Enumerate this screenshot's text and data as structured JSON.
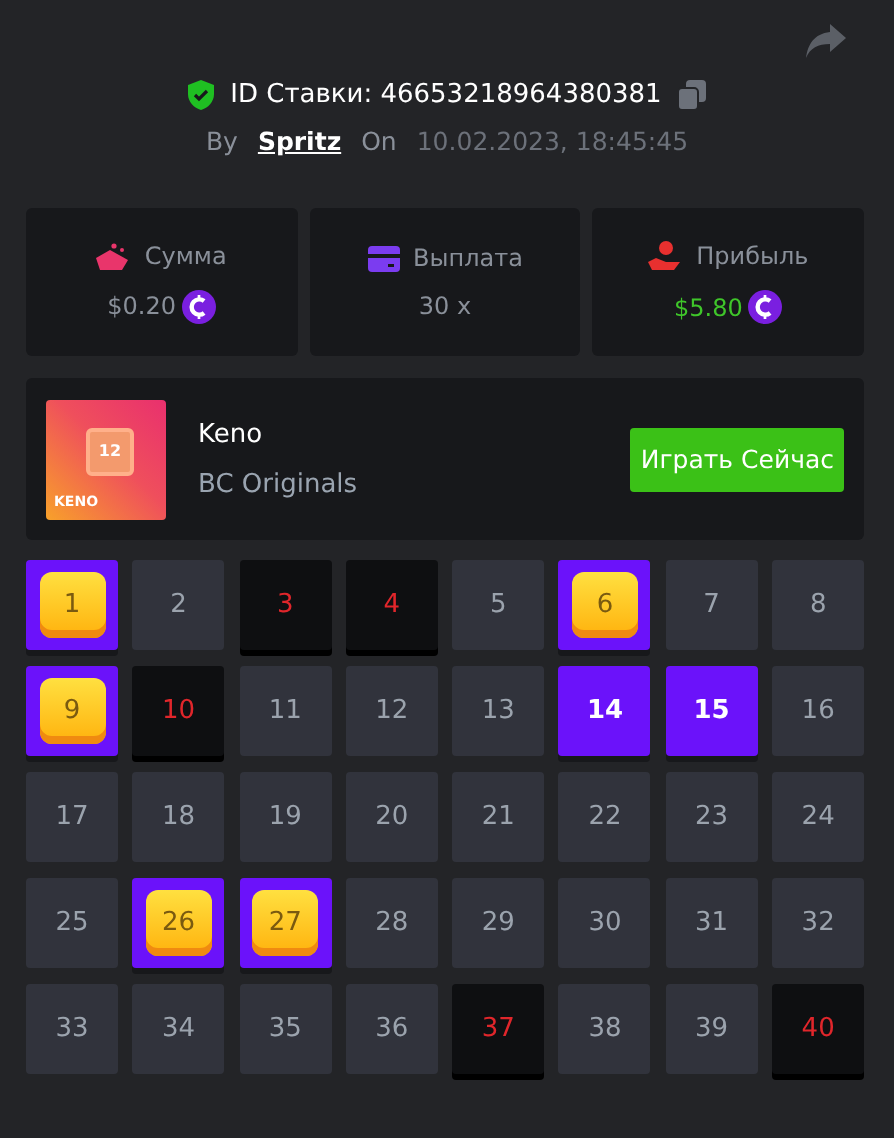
{
  "bet": {
    "id_label": "ID Ставки: 46653218964380381",
    "by_label": "By",
    "user": "Spritz",
    "on_label": "On",
    "date": "10.02.2023, 18:45:45"
  },
  "stats": [
    {
      "kind": "amount",
      "label": "Сумма",
      "value": "$0.20",
      "coin": true
    },
    {
      "kind": "payout",
      "label": "Выплата",
      "value": "30 x",
      "coin": false
    },
    {
      "kind": "profit",
      "label": "Прибыль",
      "value": "$5.80",
      "coin": true
    }
  ],
  "game": {
    "thumb_number": "12",
    "thumb_title": "KENO",
    "name": "Keno",
    "provider": "BC Originals",
    "play_button": "Играть Сейчас"
  },
  "cells": [
    {
      "number": "1",
      "kind": "hit"
    },
    {
      "number": "2",
      "kind": "plain"
    },
    {
      "number": "3",
      "kind": "drawn"
    },
    {
      "number": "4",
      "kind": "drawn"
    },
    {
      "number": "5",
      "kind": "plain"
    },
    {
      "number": "6",
      "kind": "hit"
    },
    {
      "number": "7",
      "kind": "plain"
    },
    {
      "number": "8",
      "kind": "plain"
    },
    {
      "number": "9",
      "kind": "hit"
    },
    {
      "number": "10",
      "kind": "drawn"
    },
    {
      "number": "11",
      "kind": "plain"
    },
    {
      "number": "12",
      "kind": "plain"
    },
    {
      "number": "13",
      "kind": "plain"
    },
    {
      "number": "14",
      "kind": "picked"
    },
    {
      "number": "15",
      "kind": "picked"
    },
    {
      "number": "16",
      "kind": "plain"
    },
    {
      "number": "17",
      "kind": "plain"
    },
    {
      "number": "18",
      "kind": "plain"
    },
    {
      "number": "19",
      "kind": "plain"
    },
    {
      "number": "20",
      "kind": "plain"
    },
    {
      "number": "21",
      "kind": "plain"
    },
    {
      "number": "22",
      "kind": "plain"
    },
    {
      "number": "23",
      "kind": "plain"
    },
    {
      "number": "24",
      "kind": "plain"
    },
    {
      "number": "25",
      "kind": "plain"
    },
    {
      "number": "26",
      "kind": "hit"
    },
    {
      "number": "27",
      "kind": "hit"
    },
    {
      "number": "28",
      "kind": "plain"
    },
    {
      "number": "29",
      "kind": "plain"
    },
    {
      "number": "30",
      "kind": "plain"
    },
    {
      "number": "31",
      "kind": "plain"
    },
    {
      "number": "32",
      "kind": "plain"
    },
    {
      "number": "33",
      "kind": "plain"
    },
    {
      "number": "34",
      "kind": "plain"
    },
    {
      "number": "35",
      "kind": "plain"
    },
    {
      "number": "36",
      "kind": "plain"
    },
    {
      "number": "37",
      "kind": "drawn"
    },
    {
      "number": "38",
      "kind": "plain"
    },
    {
      "number": "39",
      "kind": "plain"
    },
    {
      "number": "40",
      "kind": "drawn"
    }
  ]
}
